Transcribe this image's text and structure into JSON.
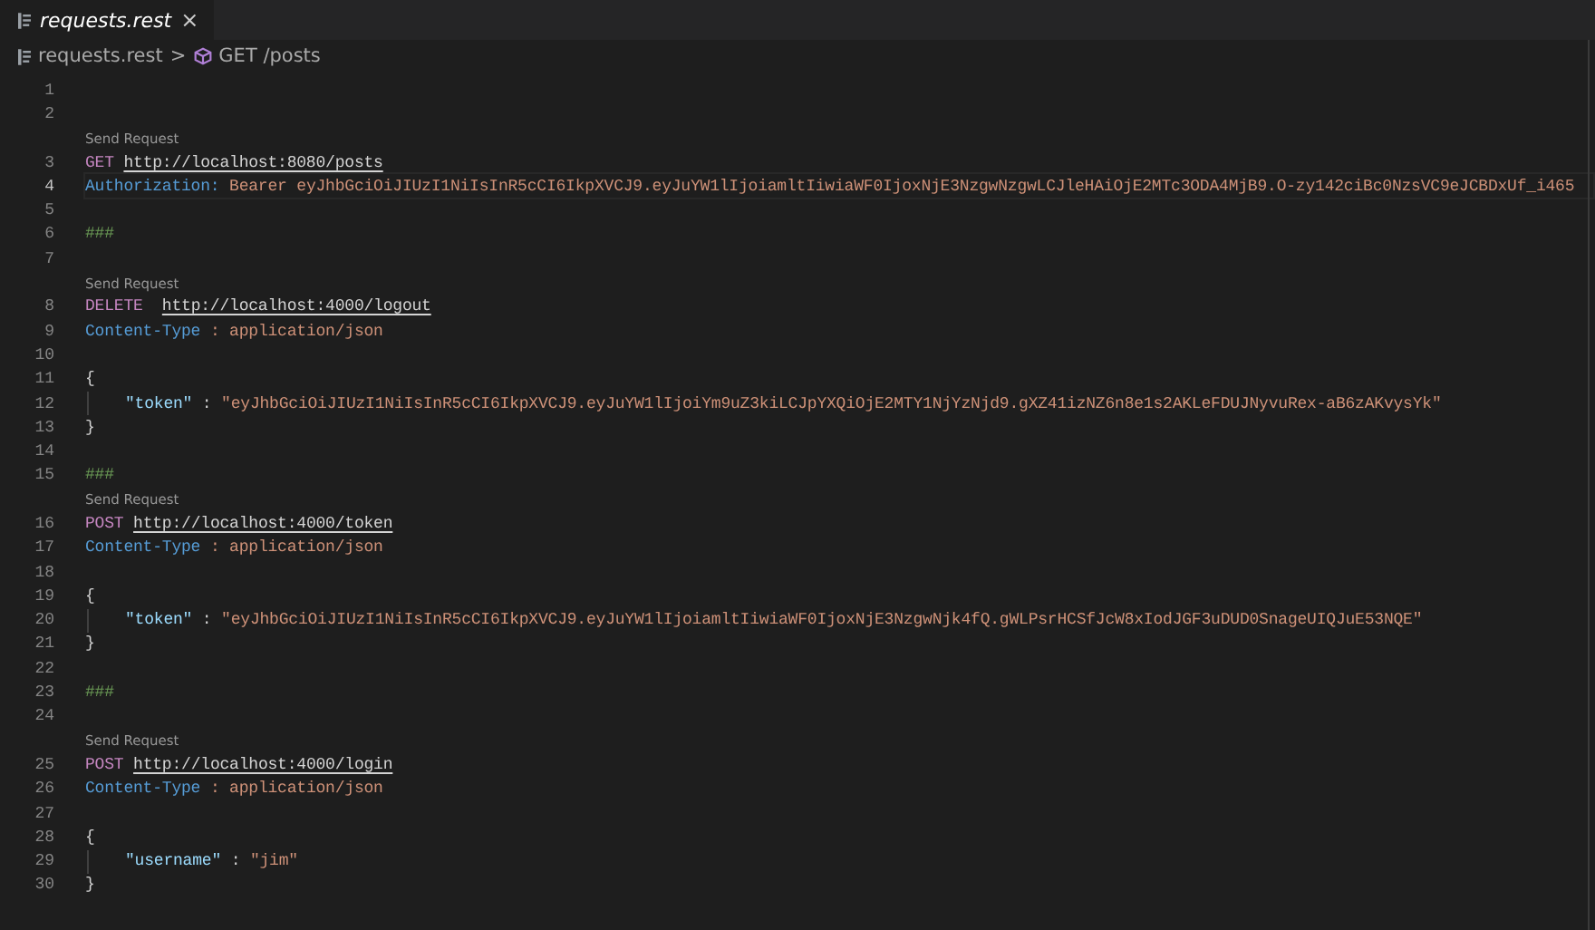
{
  "tab": {
    "label": "requests.rest",
    "close": "×",
    "selected": true
  },
  "breadcrumb": {
    "file": "requests.rest",
    "separator": ">",
    "symbol": "GET /posts"
  },
  "lines": [
    {
      "kind": "code",
      "number": "1",
      "current": false
    },
    {
      "kind": "code",
      "number": "2",
      "current": false
    },
    {
      "kind": "codelens",
      "text": "Send Request"
    },
    {
      "kind": "code",
      "number": "3",
      "current": false,
      "tokens": [
        {
          "kind": "method",
          "text": "GET"
        },
        {
          "kind": "url",
          "text": "http://localhost:8080/posts"
        }
      ]
    },
    {
      "kind": "code",
      "number": "4",
      "current": true,
      "tokens": [
        {
          "kind": "header",
          "text": "Authorization:"
        },
        {
          "kind": "value",
          "text": "Bearer eyJhbGciOiJIUzI1NiIsInR5cCI6IkpXVCJ9.eyJuYW1lIjoiamltIiwiaWF0IjoxNjE3NzgwNzgwLCJleHAiOjE2MTc3ODA4MjB9.O-zy142ciBc0NzsVC9eJCBDxUf_i465"
        }
      ]
    },
    {
      "kind": "code",
      "number": "5",
      "current": false
    },
    {
      "kind": "code",
      "number": "6",
      "current": false,
      "tokens": [
        {
          "kind": "comment",
          "text": "###"
        }
      ]
    },
    {
      "kind": "code",
      "number": "7",
      "current": false
    },
    {
      "kind": "codelens",
      "text": "Send Request"
    },
    {
      "kind": "code",
      "number": "8",
      "current": false,
      "tokens": [
        {
          "kind": "method",
          "text": "DELETE "
        },
        {
          "kind": "url",
          "text": "http://localhost:4000/logout"
        }
      ]
    },
    {
      "kind": "code",
      "number": "9",
      "current": false,
      "tokens": [
        {
          "kind": "header",
          "text": "Content-Type"
        },
        {
          "kind": "value",
          "text": ": application/json"
        }
      ]
    },
    {
      "kind": "code",
      "number": "10",
      "current": false
    },
    {
      "kind": "code",
      "number": "11",
      "current": false,
      "tokens": [
        {
          "kind": "brace",
          "text": "{"
        }
      ]
    },
    {
      "kind": "code",
      "number": "12",
      "current": false,
      "indented": true,
      "tokens": [
        {
          "kind": "key",
          "text": "\"token\""
        },
        {
          "kind": "brace",
          "text": ":"
        },
        {
          "kind": "value",
          "text": "\"eyJhbGciOiJIUzI1NiIsInR5cCI6IkpXVCJ9.eyJuYW1lIjoiYm9uZ3kiLCJpYXQiOjE2MTY1NjYzNjd9.gXZ41izNZ6n8e1s2AKLeFDUJNyvuRex-aB6zAKvysYk\""
        }
      ]
    },
    {
      "kind": "code",
      "number": "13",
      "current": false,
      "tokens": [
        {
          "kind": "brace",
          "text": "}"
        }
      ]
    },
    {
      "kind": "code",
      "number": "14",
      "current": false
    },
    {
      "kind": "code",
      "number": "15",
      "current": false,
      "tokens": [
        {
          "kind": "comment",
          "text": "###"
        }
      ]
    },
    {
      "kind": "codelens",
      "text": "Send Request"
    },
    {
      "kind": "code",
      "number": "16",
      "current": false,
      "tokens": [
        {
          "kind": "method",
          "text": "POST"
        },
        {
          "kind": "url",
          "text": "http://localhost:4000/token"
        }
      ]
    },
    {
      "kind": "code",
      "number": "17",
      "current": false,
      "tokens": [
        {
          "kind": "header",
          "text": "Content-Type"
        },
        {
          "kind": "value",
          "text": ": application/json"
        }
      ]
    },
    {
      "kind": "code",
      "number": "18",
      "current": false
    },
    {
      "kind": "code",
      "number": "19",
      "current": false,
      "tokens": [
        {
          "kind": "brace",
          "text": "{"
        }
      ]
    },
    {
      "kind": "code",
      "number": "20",
      "current": false,
      "indented": true,
      "tokens": [
        {
          "kind": "key",
          "text": "\"token\""
        },
        {
          "kind": "brace",
          "text": ":"
        },
        {
          "kind": "value",
          "text": "\"eyJhbGciOiJIUzI1NiIsInR5cCI6IkpXVCJ9.eyJuYW1lIjoiamltIiwiaWF0IjoxNjE3NzgwNjk4fQ.gWLPsrHCSfJcW8xIodJGF3uDUD0SnageUIQJuE53NQE\""
        }
      ]
    },
    {
      "kind": "code",
      "number": "21",
      "current": false,
      "tokens": [
        {
          "kind": "brace",
          "text": "}"
        }
      ]
    },
    {
      "kind": "code",
      "number": "22",
      "current": false
    },
    {
      "kind": "code",
      "number": "23",
      "current": false,
      "tokens": [
        {
          "kind": "comment",
          "text": "###"
        }
      ]
    },
    {
      "kind": "code",
      "number": "24",
      "current": false
    },
    {
      "kind": "codelens",
      "text": "Send Request"
    },
    {
      "kind": "code",
      "number": "25",
      "current": false,
      "tokens": [
        {
          "kind": "method",
          "text": "POST"
        },
        {
          "kind": "url",
          "text": "http://localhost:4000/login"
        }
      ]
    },
    {
      "kind": "code",
      "number": "26",
      "current": false,
      "tokens": [
        {
          "kind": "header",
          "text": "Content-Type"
        },
        {
          "kind": "value",
          "text": ": application/json"
        }
      ]
    },
    {
      "kind": "code",
      "number": "27",
      "current": false
    },
    {
      "kind": "code",
      "number": "28",
      "current": false,
      "tokens": [
        {
          "kind": "brace",
          "text": "{"
        }
      ]
    },
    {
      "kind": "code",
      "number": "29",
      "current": false,
      "indented": true,
      "tokens": [
        {
          "kind": "key",
          "text": "\"username\""
        },
        {
          "kind": "brace",
          "text": ":"
        },
        {
          "kind": "value",
          "text": "\"jim\""
        }
      ]
    },
    {
      "kind": "code",
      "number": "30",
      "current": false,
      "tokens": [
        {
          "kind": "brace",
          "text": "}"
        }
      ]
    }
  ]
}
